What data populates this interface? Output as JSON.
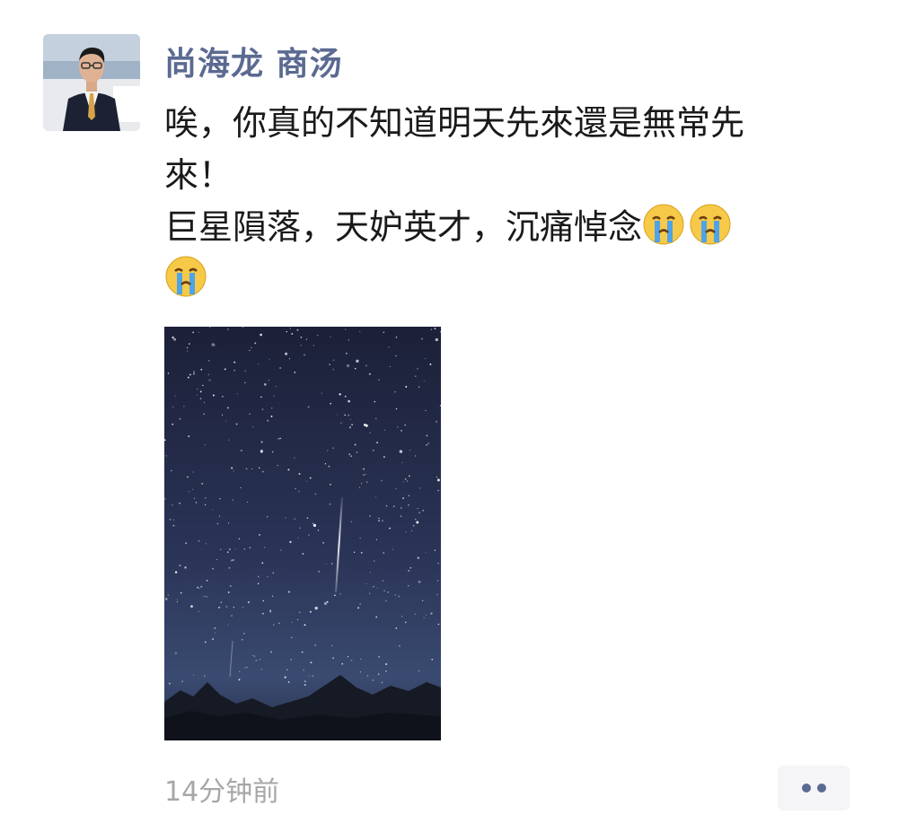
{
  "post": {
    "author": "尚海龙 商汤",
    "lines": [
      "唉，你真的不知道明天先來還是無常先",
      "來！",
      "巨星隕落，天妒英才，沉痛悼念"
    ],
    "emojis": [
      "crying-face",
      "crying-face",
      "crying-face"
    ],
    "timestamp": "14分钟前",
    "more_icon": "more-dots-icon"
  },
  "colors": {
    "author": "#5b6a91",
    "text": "#1a1a1a",
    "timestamp": "#a7a7a7",
    "more_button_bg": "#f5f5f7"
  }
}
